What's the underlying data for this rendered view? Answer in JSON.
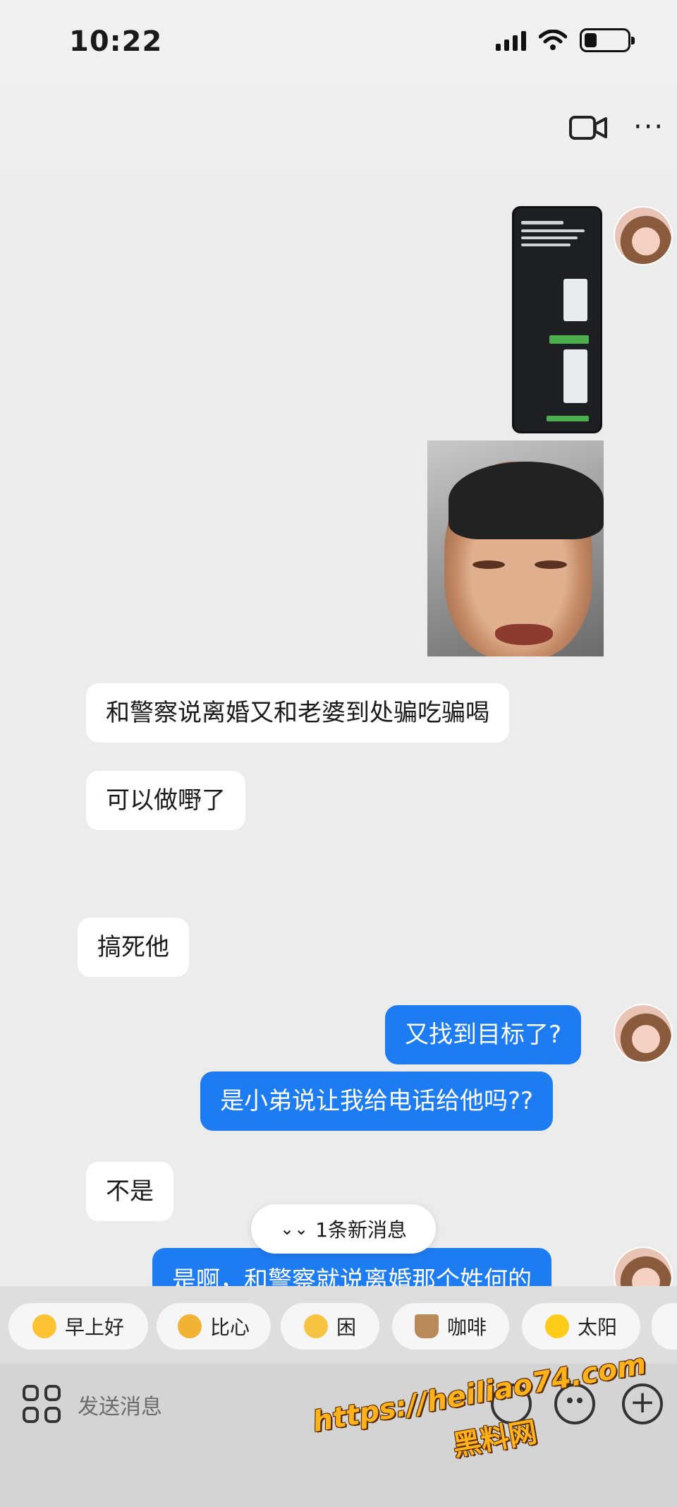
{
  "status_bar": {
    "time": "10:22",
    "icons": [
      "signal-icon",
      "wifi-icon",
      "battery-icon"
    ],
    "battery_level": 0.3
  },
  "header": {
    "icons": [
      "video-call-icon",
      "more-icon"
    ],
    "more_glyph": "···"
  },
  "messages": [
    {
      "from": "me",
      "type": "image",
      "content": "chat-screenshot"
    },
    {
      "from": "me",
      "type": "image",
      "content": "crying-face-photo"
    },
    {
      "from": "other",
      "type": "text",
      "text": "和警察说离婚又和老婆到处骗吃骗喝"
    },
    {
      "from": "other",
      "type": "text",
      "text": "可以做嘢了"
    },
    {
      "from": "other",
      "type": "text",
      "text": "搞死他"
    },
    {
      "from": "me",
      "type": "text",
      "text": "又找到目标了?"
    },
    {
      "from": "me",
      "type": "text",
      "text": "是小弟说让我给电话给他吗??"
    },
    {
      "from": "other",
      "type": "text",
      "text": "不是"
    },
    {
      "from": "me",
      "type": "text",
      "text": "是啊，和警察就说离婚那个姓何的"
    }
  ],
  "new_messages_pill": {
    "icon": "double-chevron-down-icon",
    "icon_glyph": "⌄⌄",
    "label": "1条新消息"
  },
  "quick_replies": [
    {
      "label": "早上好",
      "icon": "morning-emoji-icon"
    },
    {
      "label": "比心",
      "icon": "heart-hand-emoji-icon"
    },
    {
      "label": "困",
      "icon": "sleepy-emoji-icon"
    },
    {
      "label": "咖啡",
      "icon": "coffee-emoji-icon"
    },
    {
      "label": "太阳",
      "icon": "sun-emoji-icon"
    }
  ],
  "input_bar": {
    "placeholder": "发送消息",
    "icons": [
      "apps-icon",
      "voice-icon",
      "emoji-icon",
      "plus-icon"
    ],
    "plus_glyph": "+"
  },
  "watermark": {
    "url": "https://heiliao74.com",
    "name": "黑料网"
  },
  "colors": {
    "outgoing_bubble": "#1e7cf2",
    "incoming_bubble": "#ffffff",
    "background": "#ececec"
  }
}
